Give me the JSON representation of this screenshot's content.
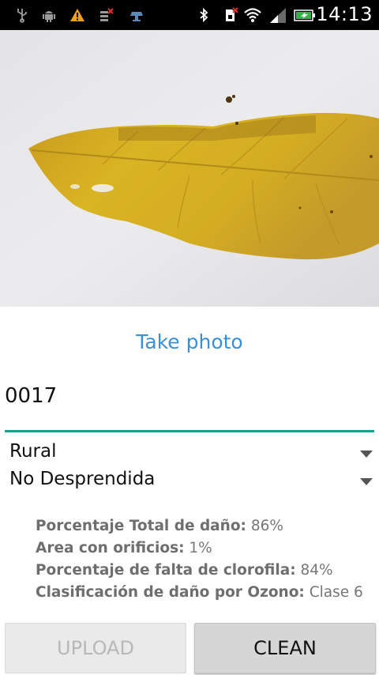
{
  "status_bar": {
    "time": "14:13",
    "icons": [
      "usb-icon",
      "android-debug-icon",
      "warning-icon",
      "no-sim-icon",
      "screen-icon",
      "bluetooth-icon",
      "sim-error-icon",
      "wifi-icon",
      "signal-icon",
      "battery-charging-icon"
    ]
  },
  "photo": {
    "subject": "leaf-photo"
  },
  "take_photo_label": "Take photo",
  "sample_id": "0017",
  "spinners": {
    "zone": "Rural",
    "state": "No Desprendida"
  },
  "results": [
    {
      "label": "Porcentaje Total de daño:",
      "value": "86%"
    },
    {
      "label": "Area con orificios:",
      "value": "1%"
    },
    {
      "label": "Porcentaje de falta de clorofila:",
      "value": "84%"
    },
    {
      "label": "Clasificación de daño por Ozono:",
      "value": "Clase 6"
    }
  ],
  "buttons": {
    "upload": "UPLOAD",
    "clean": "CLEAN"
  },
  "colors": {
    "accent": "#3a8fd9",
    "underline": "#1e9e8c",
    "status_bar": "#000000",
    "battery": "#33b54a"
  }
}
